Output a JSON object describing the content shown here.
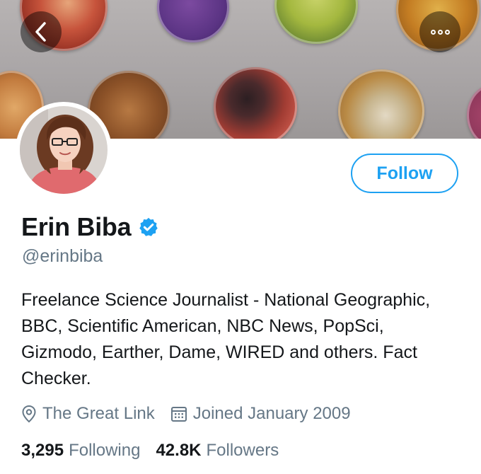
{
  "profile": {
    "display_name": "Erin Biba",
    "handle": "@erinbiba",
    "verified": true,
    "bio": "Freelance Science Journalist - National Geographic, BBC, Scientific American, NBC News, PopSci, Gizmodo, Earther, Dame, WIRED and others. Fact Checker.",
    "location": "The Great Link",
    "joined": "Joined January 2009"
  },
  "actions": {
    "follow_label": "Follow"
  },
  "stats": {
    "following_count": "3,295",
    "following_label": "Following",
    "followers_count": "42.8K",
    "followers_label": "Followers"
  },
  "icons": {
    "back": "chevron-left-icon",
    "more": "more-dots-icon",
    "verified": "verified-badge-icon",
    "location": "location-pin-icon",
    "calendar": "calendar-icon"
  },
  "colors": {
    "accent": "#1da1f2",
    "text_primary": "#14171a",
    "text_secondary": "#657786"
  }
}
